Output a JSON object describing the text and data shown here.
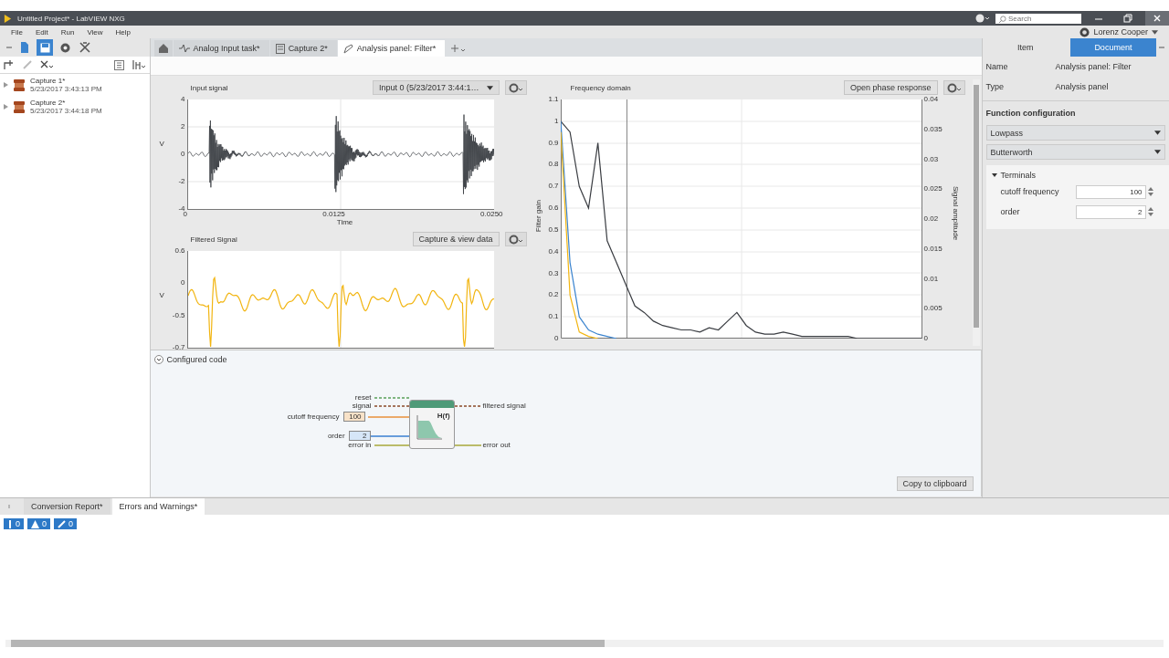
{
  "window": {
    "title": "Untitled Project* - LabVIEW NXG",
    "search_placeholder": "Search"
  },
  "menu": [
    "File",
    "Edit",
    "Run",
    "View",
    "Help"
  ],
  "user": "Lorenz Cooper",
  "nav_buttons": [
    {
      "kind": "page",
      "selected": false
    },
    {
      "kind": "save",
      "selected": true
    },
    {
      "kind": "globe",
      "selected": false
    },
    {
      "kind": "tools",
      "selected": false
    }
  ],
  "tree": [
    {
      "name": "Capture 1*",
      "date": "5/23/2017 3:43:13 PM"
    },
    {
      "name": "Capture 2*",
      "date": "5/23/2017 3:44:18 PM"
    }
  ],
  "doc_tabs": [
    {
      "kind": "task",
      "label": "Analog Input task*",
      "selected": false
    },
    {
      "kind": "capture",
      "label": "Capture 2*",
      "selected": false
    },
    {
      "kind": "panel",
      "label": "Analysis panel: Filter*",
      "selected": true
    }
  ],
  "input_chart": {
    "title": "Input signal",
    "source": "Input 0 (5/23/2017 3:44:1…",
    "ylabel": "V",
    "yticks": [
      "4",
      "2",
      "0",
      "-2",
      "-4"
    ],
    "xticks": [
      "0",
      "0.0125",
      "0.0250"
    ],
    "xlabel": "Time"
  },
  "filtered_chart": {
    "title": "Filtered Signal",
    "button": "Capture & view data",
    "ylabel": "V",
    "yticks": [
      "0.6",
      "0",
      "-0.5",
      "-0.7"
    ]
  },
  "frequency_chart": {
    "title": "Frequency domain",
    "button": "Open phase response",
    "y2label": "Signal amplitude",
    "y2ticks": [
      "0.04",
      "0.035",
      "0.03",
      "0.025",
      "0.02",
      "0.015",
      "0.01",
      "0.005",
      "0"
    ],
    "chart_data": {
      "type": "line",
      "ylabel": "Filter gain",
      "ylim": [
        0,
        1.1
      ],
      "grid": true,
      "yticks": [
        1.1,
        1,
        0.9,
        0.8,
        0.7,
        0.6,
        0.5,
        0.4,
        0.3,
        0.2,
        0.1,
        0
      ],
      "series": [
        {
          "color": "#3a3d42",
          "values": [
            1.0,
            0.95,
            0.7,
            0.6,
            0.9,
            0.45,
            0.35,
            0.25,
            0.15,
            0.12,
            0.08,
            0.06,
            0.05,
            0.04,
            0.04,
            0.03,
            0.05,
            0.04,
            0.08,
            0.12,
            0.06,
            0.03,
            0.02,
            0.02,
            0.03,
            0.02,
            0.01,
            0.01,
            0.01,
            0.01,
            0.01,
            0.01,
            0,
            0,
            0,
            0,
            0,
            0,
            0,
            0
          ]
        },
        {
          "color": "#3b84cf",
          "values": [
            1,
            0.35,
            0.1,
            0.04,
            0.02,
            0.01,
            0,
            null,
            null,
            null,
            null,
            null,
            null,
            null,
            null,
            null,
            null,
            null,
            null,
            null,
            null,
            null,
            null,
            null,
            null,
            null,
            null,
            null,
            null,
            null,
            null,
            null,
            null,
            null,
            null,
            null,
            null,
            null,
            null,
            null
          ]
        },
        {
          "color": "#f2b511",
          "values": [
            0.95,
            0.2,
            0.03,
            0.01,
            0,
            null,
            null,
            null,
            null,
            null,
            null,
            null,
            null,
            null,
            null,
            null,
            null,
            null,
            null,
            null,
            null,
            null,
            null,
            null,
            null,
            null,
            null,
            null,
            null,
            null,
            null,
            null,
            null,
            null,
            null,
            null,
            null,
            null,
            null,
            null
          ]
        }
      ]
    }
  },
  "code": {
    "title": "Configured code",
    "expanded": true,
    "node": "H(f)",
    "inputs": [
      {
        "label": "reset",
        "kind": "boolean"
      },
      {
        "label": "signal",
        "kind": "waveform"
      },
      {
        "label": "cutoff frequency",
        "kind": "numeric",
        "constant": "100"
      },
      {
        "label": "order",
        "kind": "integer",
        "constant": "2"
      },
      {
        "label": "error in",
        "kind": "error"
      }
    ],
    "outputs": [
      {
        "label": "filtered signal",
        "kind": "waveform"
      },
      {
        "label": "error out",
        "kind": "error"
      }
    ],
    "button": "Copy to clipboard"
  },
  "properties": {
    "tabs": [
      {
        "label": "Item",
        "selected": false
      },
      {
        "label": "Document",
        "selected": true
      }
    ],
    "fields": [
      {
        "label": "Name",
        "value": "Analysis panel: Filter"
      },
      {
        "label": "Type",
        "value": "Analysis panel"
      }
    ],
    "section": "Function configuration",
    "dropdowns": [
      "Lowpass",
      "Butterworth"
    ],
    "terminals": {
      "title": "Terminals",
      "expanded": true,
      "rows": [
        {
          "label": "cutoff frequency",
          "value": "100"
        },
        {
          "label": "order",
          "value": "2"
        }
      ]
    }
  },
  "bottom_tabs": [
    {
      "label": "Conversion Report*",
      "selected": false
    },
    {
      "label": "Errors and Warnings*",
      "selected": true
    }
  ],
  "filters": [
    {
      "kind": "error",
      "count": "0"
    },
    {
      "kind": "warning",
      "count": "0"
    },
    {
      "kind": "info",
      "count": "0"
    }
  ]
}
